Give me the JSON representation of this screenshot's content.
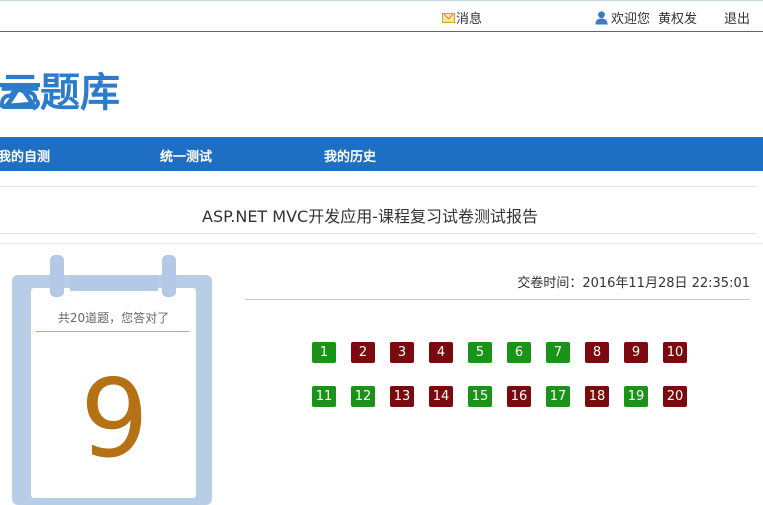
{
  "header": {
    "messages_label": "消息",
    "welcome_label": "欢迎您",
    "user_name": "黄权发",
    "logout_label": "退出"
  },
  "logo": {
    "text": "云题库"
  },
  "nav": {
    "items": [
      {
        "label": "我的自测"
      },
      {
        "label": "统一测试"
      },
      {
        "label": "我的历史"
      }
    ]
  },
  "report": {
    "title": "ASP.NET MVC开发应用-课程复习试卷测试报告",
    "submit_time": "交卷时间：2016年11月28日 22:35:01",
    "summary": "共20道题，您答对了",
    "score": "9"
  },
  "questions": [
    {
      "n": "1",
      "correct": true
    },
    {
      "n": "2",
      "correct": false
    },
    {
      "n": "3",
      "correct": false
    },
    {
      "n": "4",
      "correct": false
    },
    {
      "n": "5",
      "correct": true
    },
    {
      "n": "6",
      "correct": true
    },
    {
      "n": "7",
      "correct": true
    },
    {
      "n": "8",
      "correct": false
    },
    {
      "n": "9",
      "correct": false
    },
    {
      "n": "10",
      "correct": false
    },
    {
      "n": "11",
      "correct": true
    },
    {
      "n": "12",
      "correct": true
    },
    {
      "n": "13",
      "correct": false
    },
    {
      "n": "14",
      "correct": false
    },
    {
      "n": "15",
      "correct": true
    },
    {
      "n": "16",
      "correct": false
    },
    {
      "n": "17",
      "correct": true
    },
    {
      "n": "18",
      "correct": false
    },
    {
      "n": "19",
      "correct": true
    },
    {
      "n": "20",
      "correct": false
    }
  ],
  "colors": {
    "nav_bg": "#1e6fc3",
    "correct": "#1a9318",
    "wrong": "#7a0a0e",
    "score": "#b57214",
    "logo": "#2c7cc9"
  }
}
